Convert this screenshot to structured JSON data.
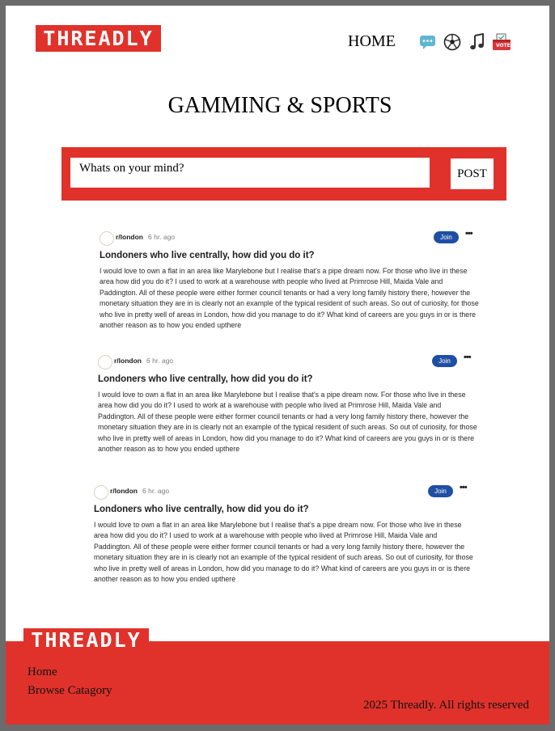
{
  "brand": {
    "logo_text": "THREADLY",
    "accent_color": "#e0322b"
  },
  "nav": {
    "home_label": "HOME",
    "icons": [
      "chat-icon",
      "soccer-ball-icon",
      "music-note-icon",
      "vote-icon"
    ],
    "vote_icon_text": "VOTE"
  },
  "page": {
    "title": "GAMMING & SPORTS"
  },
  "composer": {
    "placeholder": "Whats on your mind?",
    "post_label": "POST"
  },
  "posts": [
    {
      "subreddit": "r/london",
      "time": "6 hr. ago",
      "join_label": "Join",
      "title": "Londoners who live centrally, how did you do it?",
      "body": "I would love to own a flat in an area like Marylebone but I realise that's a pipe dream now. For those who live in these area how did you do it? I used to work at a warehouse with people who lived at Primrose Hill, Maida Vale and Paddington. All of these people were either former council tenants or had a very long family history there, however the monetary situation they are in is clearly not an example of the typical resident of such areas. So out of curiosity, for those who live in pretty well of areas in London, how did you manage to do it? What kind of careers are you guys in or is there another reason as to how you ended upthere"
    },
    {
      "subreddit": "r/london",
      "time": "6 hr. ago",
      "join_label": "Join",
      "title": "Londoners who live centrally, how did you do it?",
      "body": "I would love to own a flat in an area like Marylebone but I realise that's a pipe dream now. For those who live in these area how did you do it? I used to work at a warehouse with people who lived at Primrose Hill, Maida Vale and Paddington. All of these people were either former council tenants or had a very long family history there, however the monetary situation they are in is clearly not an example of the typical resident of such areas. So out of curiosity, for those who live in pretty well of areas in London, how did you manage to do it? What kind of careers are you guys in or is there another reason as to how you ended upthere"
    },
    {
      "subreddit": "r/london",
      "time": "6 hr. ago",
      "join_label": "Join",
      "title": "Londoners who live centrally, how did you do it?",
      "body": "I would love to own a flat in an area like Marylebone but I realise that's a pipe dream now. For those who live in these area how did you do it? I used to work at a warehouse with people who lived at Primrose Hill, Maida Vale and Paddington. All of these people were either former council tenants or had a very long family history there, however the monetary situation they are in is clearly not an example of the typical resident of such areas. So out of curiosity, for those who live in pretty well of areas in London, how did you manage to do it? What kind of careers are you guys in or is there another reason as to how you ended upthere"
    }
  ],
  "footer": {
    "links": [
      "Home",
      "Browse Catagory"
    ],
    "copyright": "2025 Threadly. All rights reserved"
  }
}
